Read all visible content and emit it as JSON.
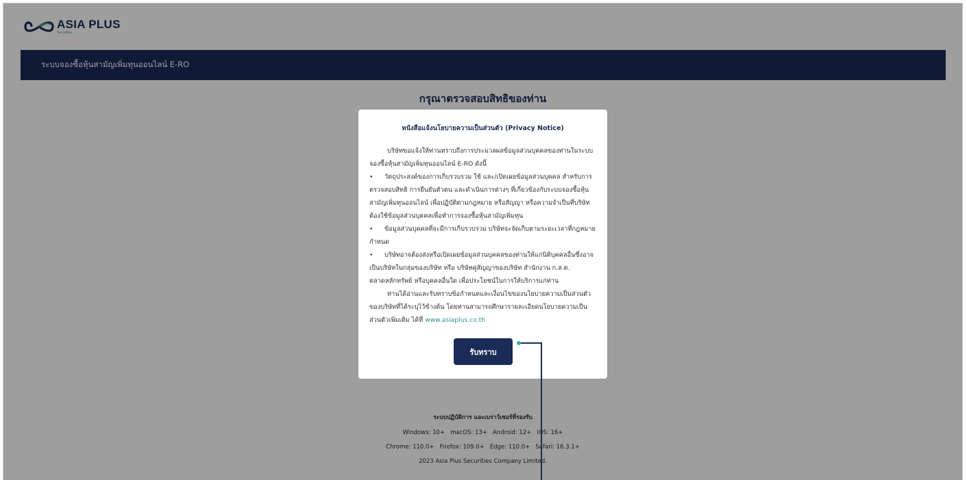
{
  "brand": {
    "name": "ASIA PLUS",
    "sub": "Securities"
  },
  "nav": {
    "title": "ระบบจองซื้อหุ้นสามัญเพิ่มทุนออนไลน์ E-RO"
  },
  "page": {
    "heading": "กรุณาตรวจสอบสิทธิของท่าน"
  },
  "modal": {
    "title": "หนังสือแจ้งนโยบายความเป็นส่วนตัว (Privacy Notice)",
    "intro": "บริษัทขอแจ้งให้ท่านทราบถึงการประมวลผลข้อมูลส่วนบุคคลของท่านในระบบจองซื้อหุ้นสามัญเพิ่มทุนออนไลน์ E-RO ดังนี้",
    "bullet1": "วัตถุประสงค์ของการเก็บรวบรวม ใช้ และ/เปิดเผยข้อมูลส่วนบุคคล สำหรับการตรวจสอบสิทธิ การยืนยันตัวตน และดำเนินการต่างๆ ที่เกี่ยวข้องกับระบบจองซื้อหุ้นสามัญเพิ่มทุนออนไลน์ เพื่อปฏิบัติตามกฎหมาย หรือสัญญา หรือความจำเป็นที่บริษัทต้องใช้ข้อมูลส่วนบุคคลเพื่อทำการจองซื้อหุ้นสามัญเพิ่มทุน",
    "bullet2": "ข้อมูลส่วนบุคคลที่จะมีการเก็บรวบรวม บริษัทจะจัดเก็บตามระยะเวลาที่กฎหมายกำหนด",
    "bullet3": "บริษัทอาจต้องส่งหรือเปิดเผยข้อมูลส่วนบุคคลของท่านให้แก่นิติบุคคลอื่นซึ่งอาจเป็นบริษัทในกลุ่มของบริษัท หรือ บริษัทคู่สัญญาของบริษัท สำนักงาน ก.ล.ต. ตลาดหลักทรัพย์ หรือบุคคลอื่นใด เพื่อประโยชน์ในการให้บริการแก่ท่าน",
    "closing": "ท่านได้อ่านและรับทราบข้อกำหนดและเงื่อนไขของนโยบายความเป็นส่วนตัวของบริษัทที่ได้ระบุไว้ข้างต้น โดยท่านสามารถศึกษารายละเอียดนโยบายความเป็นส่วนตัวเพิ่มเติม ได้ที่",
    "link": "www.asiaplus.co.th",
    "button": "รับทราบ"
  },
  "footer": {
    "title": "ระบบปฏิบัติการ และเบราว์เซอร์ที่รองรับ",
    "os": "Windows: 10+   macOS: 13+   Android: 12+   iOS: 16+",
    "browsers": "Chrome: 110.0+   Firefox: 109.0+   Edge: 110.0+   Safari: 16.3.1+",
    "copyright": "2023 Asia Plus Securities Company Limited."
  },
  "colors": {
    "navy": "#1b2b57",
    "teal": "#3aa9a0",
    "overlay": "rgba(0,0,0,0.38)"
  }
}
